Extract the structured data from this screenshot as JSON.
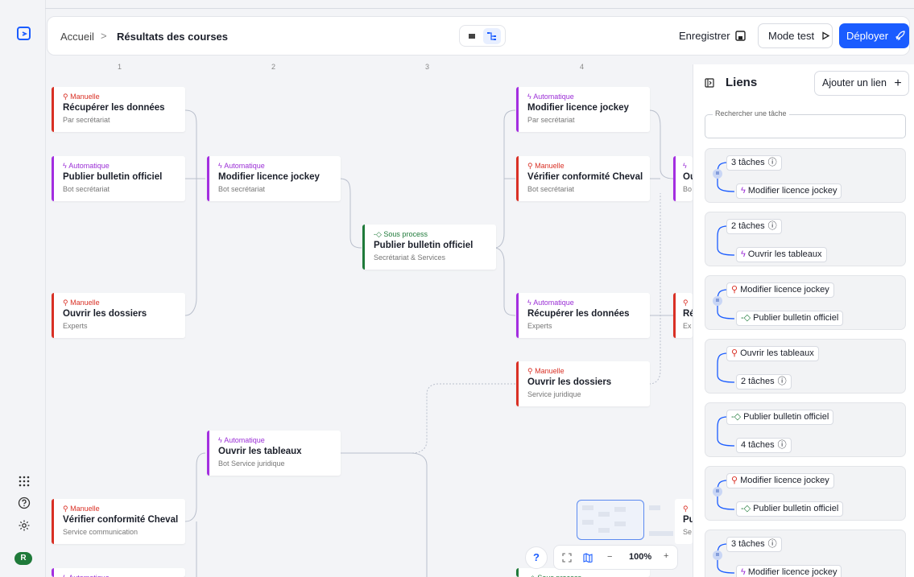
{
  "breadcrumb": {
    "home": "Accueil",
    "separator": ">",
    "current": "Résultats des courses"
  },
  "header": {
    "save_label": "Enregistrer",
    "test_label": "Mode test",
    "deploy_label": "Déployer"
  },
  "columns": [
    "1",
    "2",
    "3",
    "4"
  ],
  "cards": [
    {
      "kind": "Manuelle",
      "title": "Récupérer les données",
      "sub": "Par secrétariat"
    },
    {
      "kind": "Automatique",
      "title": "Publier bulletin officiel",
      "sub": "Bot secrétariat"
    },
    {
      "kind": "Manuelle",
      "title": "Ouvrir les dossiers",
      "sub": "Experts"
    },
    {
      "kind": "Manuelle",
      "title": "Vérifier conformité Cheval",
      "sub": "Service communication"
    },
    {
      "kind": "Automatique",
      "title": "",
      "sub": ""
    },
    {
      "kind": "Automatique",
      "title": "Modifier licence jockey",
      "sub": "Bot secrétariat"
    },
    {
      "kind": "Automatique",
      "title": "Ouvrir les tableaux",
      "sub": "Bot Service juridique"
    },
    {
      "kind": "Sous process",
      "title": "Publier bulletin officiel",
      "sub": "Secrétariat & Services"
    },
    {
      "kind": "Automatique",
      "title": "Modifier licence jockey",
      "sub": "Par secrétariat"
    },
    {
      "kind": "Manuelle",
      "title": "Vérifier conformité Cheval",
      "sub": "Bot secrétariat"
    },
    {
      "kind": "Automatique",
      "title": "Récupérer les données",
      "sub": "Experts"
    },
    {
      "kind": "Manuelle",
      "title": "Ouvrir les dossiers",
      "sub": "Service juridique"
    },
    {
      "kind": "Sous process",
      "title": "",
      "sub": ""
    },
    {
      "kind": "",
      "title": "Ou",
      "sub": "Bo"
    },
    {
      "kind": "",
      "title": "Ré",
      "sub": "Ex"
    },
    {
      "kind": "",
      "title": "Pu",
      "sub": "Se"
    }
  ],
  "panel": {
    "title": "Liens",
    "add_label": "Ajouter un lien",
    "search_label": "Rechercher une tâche",
    "links": [
      {
        "top": "3 tâches",
        "bottom": "Modifier licence jockey"
      },
      {
        "top": "2 tâches",
        "bottom": "Ouvrir les tableaux"
      },
      {
        "top": "Modifier licence jockey",
        "bottom": "Publier bulletin officiel"
      },
      {
        "top": "Ouvrir les tableaux",
        "bottom": "2 tâches"
      },
      {
        "top": "Publier bulletin officiel",
        "bottom": "4 tâches"
      },
      {
        "top": "Modifier licence jockey",
        "bottom": "Publier bulletin officiel"
      },
      {
        "top": "3 tâches",
        "bottom": "Modifier licence jockey"
      }
    ]
  },
  "zoom": {
    "help": "?",
    "level": "100%",
    "minus": "−",
    "plus": "+"
  },
  "user": {
    "initial": "R"
  },
  "colors": {
    "accent": "#1a5cff",
    "manual": "#d93025",
    "automatic": "#a32ee0",
    "subprocess": "#1f7a3a"
  }
}
